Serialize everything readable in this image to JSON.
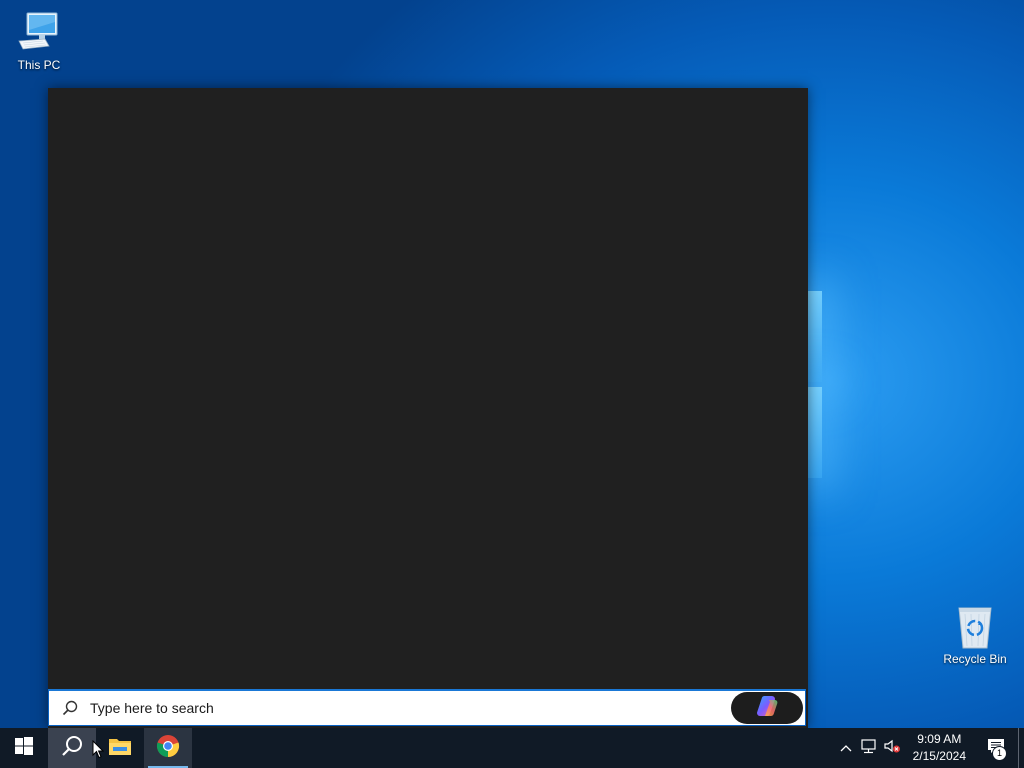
{
  "desktop": {
    "icons": [
      {
        "label": "This PC",
        "icon": "computer-icon"
      },
      {
        "label": "Recycle Bin",
        "icon": "recycle-bin-icon"
      }
    ],
    "wallpaper_color": "#0a7ad8"
  },
  "search": {
    "placeholder": "Type here to search",
    "value": "",
    "panel_color": "#202020",
    "copilot_icon": "copilot-icon"
  },
  "taskbar": {
    "background": "#101a26",
    "pinned": [
      {
        "name": "start",
        "icon": "windows-logo-icon"
      },
      {
        "name": "search",
        "icon": "search-icon",
        "active": true
      },
      {
        "name": "file-explorer",
        "icon": "folder-icon"
      },
      {
        "name": "chrome",
        "icon": "chrome-icon",
        "running": true
      }
    ],
    "tray": {
      "time": "9:09 AM",
      "date": "2/15/2024",
      "notification_count": "1"
    }
  }
}
